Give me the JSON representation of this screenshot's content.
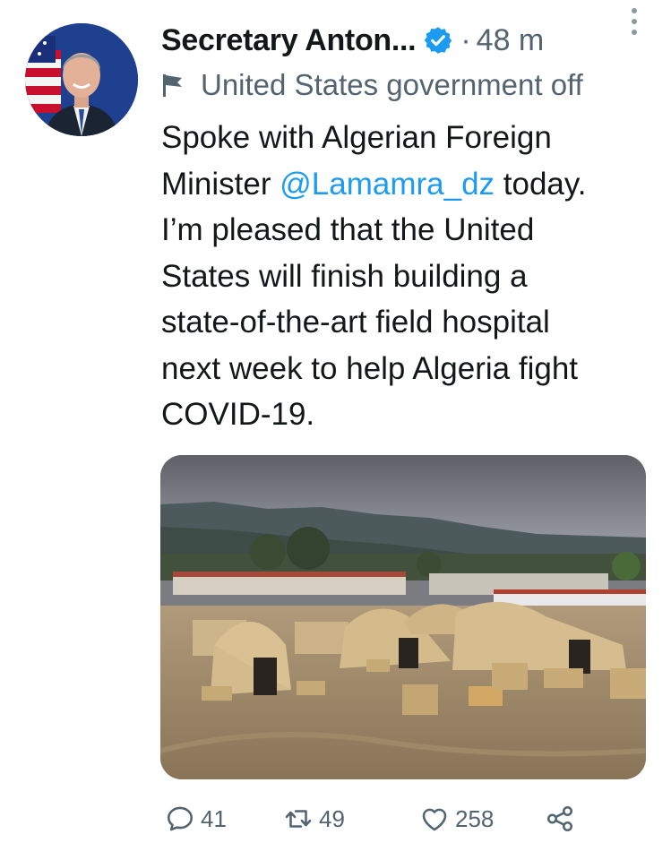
{
  "author": {
    "name": "Secretary Anton...",
    "time": "48 m",
    "separator": "·"
  },
  "label": {
    "text": "United States government off",
    "icon": "flag-icon"
  },
  "tweet": {
    "text_before_mention": "Spoke with Algerian Foreign\nMinister ",
    "mention": "@Lamamra_dz",
    "text_after_mention": " today.\nI’m pleased that the United\nStates will finish building a\nstate-of-the-art field hospital\nnext week to help Algeria fight\nCOVID-19."
  },
  "actions": {
    "reply_count": "41",
    "retweet_count": "49",
    "like_count": "258"
  },
  "colors": {
    "accent": "#1d9bf0",
    "secondary_text": "#536471",
    "primary_text": "#14171a"
  },
  "icons": [
    "verified-badge-icon",
    "more-options-icon",
    "flag-icon",
    "reply-icon",
    "retweet-icon",
    "like-icon",
    "share-icon"
  ]
}
